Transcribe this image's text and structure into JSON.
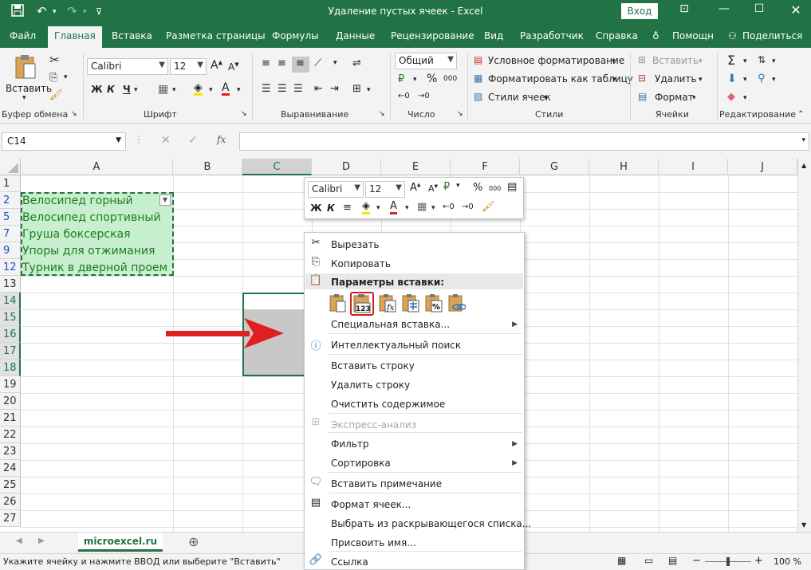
{
  "window": {
    "title": "Удаление пустых ячеек  -  Excel",
    "signin": "Вход"
  },
  "ribbon_tabs": [
    "Файл",
    "Главная",
    "Вставка",
    "Разметка страницы",
    "Формулы",
    "Данные",
    "Рецензирование",
    "Вид",
    "Разработчик",
    "Справка",
    "Помощн",
    "Поделиться"
  ],
  "ribbon": {
    "clipboard": {
      "paste": "Вставить",
      "label": "Буфер обмена"
    },
    "font": {
      "name": "Calibri",
      "size": "12",
      "bold": "Ж",
      "italic": "К",
      "underline": "Ч",
      "label": "Шрифт"
    },
    "alignment": {
      "label": "Выравнивание"
    },
    "number": {
      "format": "Общий",
      "percent": "%",
      "thousands": "000",
      "label": "Число"
    },
    "styles": {
      "conditional": "Условное форматирование",
      "as_table": "Форматировать как таблицу",
      "cell_styles": "Стили ячеек",
      "label": "Стили"
    },
    "cells": {
      "insert": "Вставить",
      "delete": "Удалить",
      "format": "Формат",
      "label": "Ячейки"
    },
    "editing": {
      "label": "Редактирование"
    }
  },
  "formula_bar": {
    "name_box": "C14",
    "fx": "fx",
    "value": ""
  },
  "columns": [
    "A",
    "B",
    "C",
    "D",
    "E",
    "F",
    "G",
    "H",
    "I",
    "J"
  ],
  "rows": [
    "1",
    "2",
    "5",
    "7",
    "9",
    "12",
    "13",
    "14",
    "15",
    "16",
    "17",
    "18",
    "19",
    "20",
    "21",
    "22",
    "23",
    "24",
    "25",
    "26",
    "27"
  ],
  "cells": {
    "A2": "Велосипед горный",
    "A5": "Велосипед спортивный",
    "A7": "Груша боксерская",
    "A9": "Упоры для отжимания",
    "A12": "Турник в дверной проем"
  },
  "mini_toolbar": {
    "font": "Calibri",
    "size": "12",
    "bold": "Ж",
    "italic": "К",
    "percent": "%",
    "thousands": "000"
  },
  "context_menu": {
    "cut": "Вырезать",
    "copy": "Копировать",
    "paste_options": "Параметры вставки:",
    "paste_values_label": "123",
    "paste_special": "Специальная вставка...",
    "smart_lookup": "Интеллектуальный поиск",
    "insert_row": "Вставить строку",
    "delete_row": "Удалить строку",
    "clear_contents": "Очистить содержимое",
    "quick_analysis": "Экспресс-анализ",
    "filter": "Фильтр",
    "sort": "Сортировка",
    "insert_comment": "Вставить примечание",
    "format_cells": "Формат ячеек...",
    "pick_from_list": "Выбрать из раскрывающегося списка...",
    "define_name": "Присвоить имя...",
    "link": "Ссылка"
  },
  "sheet": {
    "tab": "microexcel.ru"
  },
  "status": {
    "text": "Укажите ячейку и нажмите ВВОД или выберите \"Вставить\"",
    "zoom": "100 %"
  },
  "colors": {
    "excel_green": "#217346",
    "highlight_fill": "#c6efce",
    "highlight_text": "#1e7b1e",
    "arrow_red": "#e02020",
    "paste_highlight": "#d62020"
  }
}
